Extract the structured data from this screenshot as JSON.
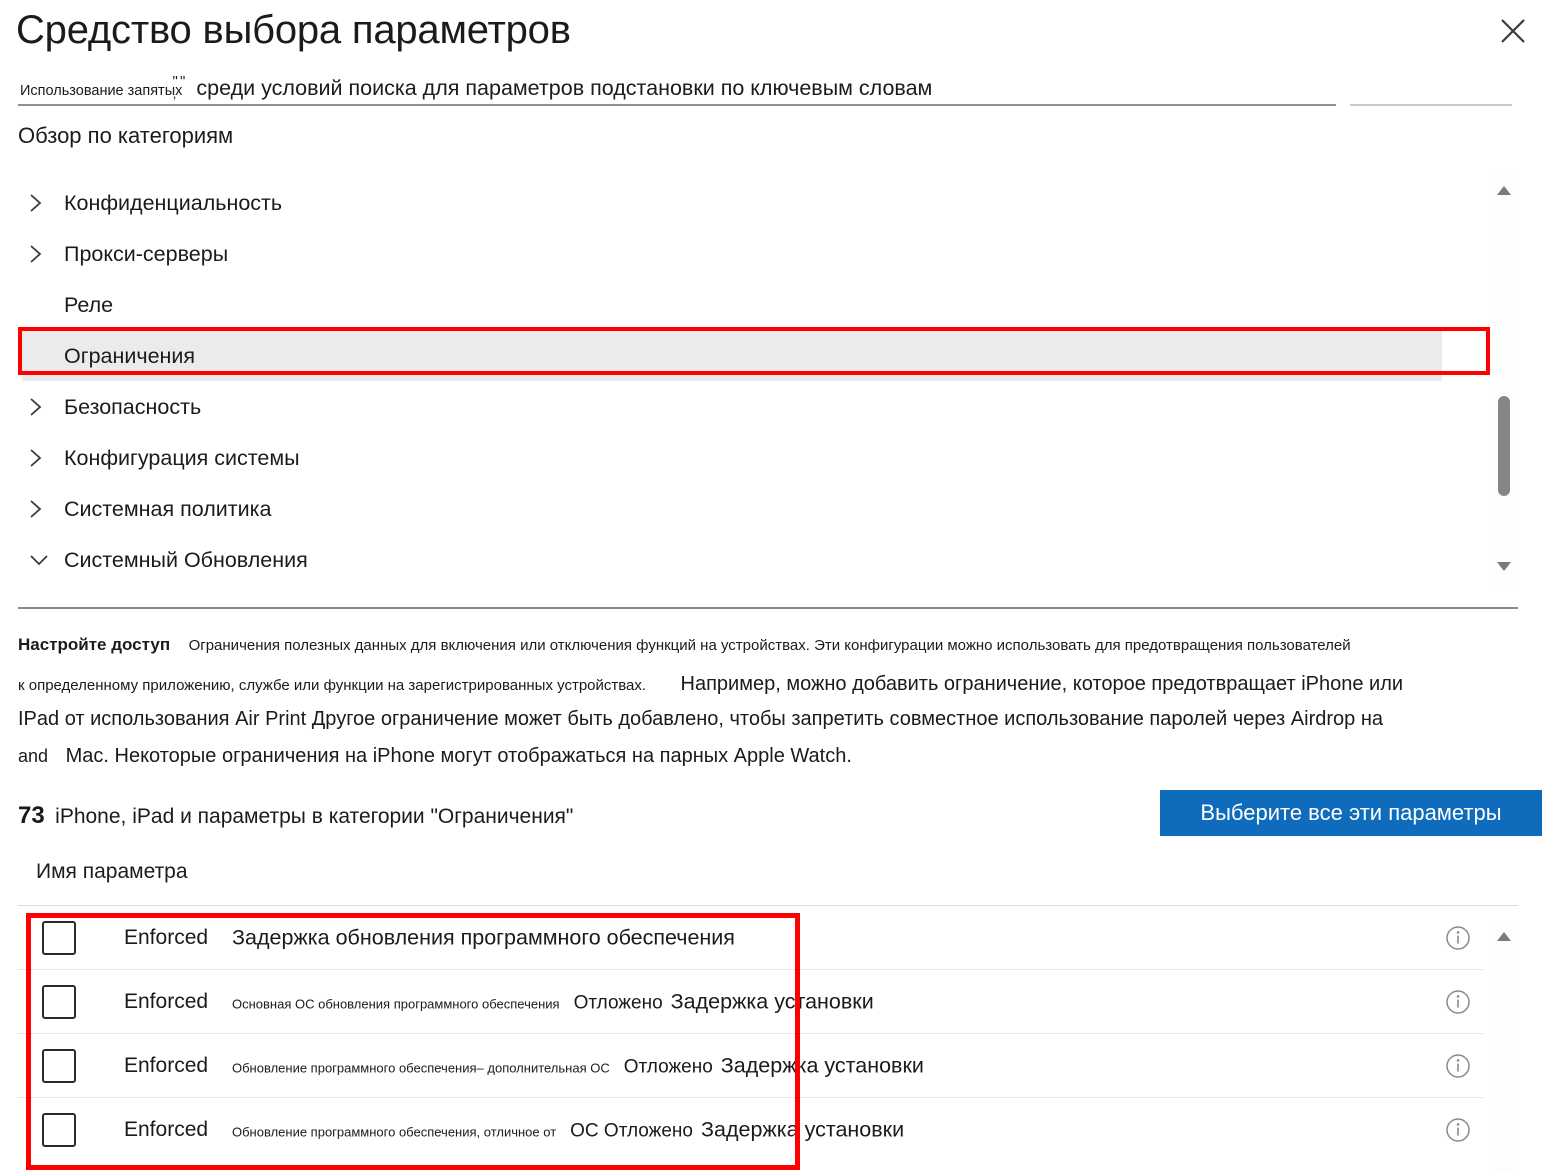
{
  "header": {
    "title": "Средство выбора параметров",
    "close_icon": "close-icon"
  },
  "search": {
    "prefix": "Использование запятых",
    "quote_glyph": "\"  \"",
    "comma_glyph": ",",
    "value": "среди условий поиска для параметров подстановки по ключевым словам"
  },
  "tree": {
    "heading": "Обзор по категориям",
    "items": [
      {
        "label": "Конфиденциальность",
        "expander": "chevron-right-icon",
        "selected": false
      },
      {
        "label": "Прокси-серверы",
        "expander": "chevron-right-icon",
        "selected": false
      },
      {
        "label": "Реле",
        "expander": "none",
        "selected": false
      },
      {
        "label": "Ограничения",
        "expander": "none",
        "selected": true
      },
      {
        "label": "Безопасность",
        "expander": "chevron-right-icon",
        "selected": false
      },
      {
        "label": "Конфигурация системы",
        "expander": "chevron-right-icon",
        "selected": false
      },
      {
        "label": "Системная политика",
        "expander": "chevron-right-icon",
        "selected": false
      },
      {
        "label": "Системный Обновления",
        "expander": "chevron-down-icon",
        "selected": false
      }
    ]
  },
  "description": {
    "lead": "Настройте доступ",
    "line1": "Ограничения полезных данных для включения или отключения функций на устройствах. Эти конфигурации можно использовать для предотвращения пользователей",
    "line2a": "к определенному приложению, службе или функции на зарегистрированных устройствах.",
    "line2b": "Например, можно добавить ограничение, которое предотвращает iPhone или",
    "line3": "IPad от использования Air Print Другое ограничение может быть добавлено, чтобы запретить совместное использование паролей через Airdrop на",
    "line4a": "and",
    "line4b": "Mac. Некоторые ограничения на iPhone могут отображаться на парных Apple Watch."
  },
  "results": {
    "count": "73",
    "count_text": "iPhone, iPad и параметры в категории \"Ограничения\"",
    "select_all_label": "Выберите все эти параметры",
    "column_header": "Имя параметра"
  },
  "rows": [
    {
      "checkbox": "unchecked",
      "enforced": "Enforced",
      "name_small": "",
      "name_mid": "",
      "name_big": "Задержка обновления программного обеспечения",
      "info": "info-icon"
    },
    {
      "checkbox": "unchecked",
      "enforced": "Enforced",
      "name_small": "Основная ОС обновления программного обеспечения",
      "name_mid": "Отложено",
      "name_big": "Задержка установки",
      "info": "info-icon"
    },
    {
      "checkbox": "unchecked",
      "enforced": "Enforced",
      "name_small": "Обновление программного обеспечения– дополнительная ОС",
      "name_mid": "Отложено",
      "name_big": "Задержка установки",
      "info": "info-icon"
    },
    {
      "checkbox": "unchecked",
      "enforced": "Enforced",
      "name_small": "Обновление программного обеспечения, отличное от",
      "name_mid": "ОС  Отложено",
      "name_big": "Задержка установки",
      "info": "info-icon"
    }
  ],
  "colors": {
    "accent": "#0f6cbd",
    "highlight_box": "#ff0000",
    "selected_row": "#ebebeb",
    "scrollbar_thumb": "#868686"
  }
}
